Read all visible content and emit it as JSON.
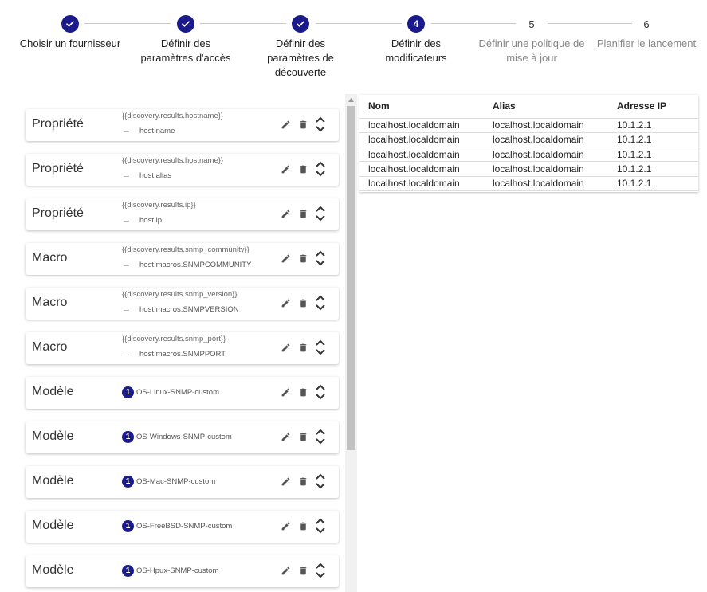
{
  "stepper": {
    "steps": [
      {
        "label": "Choisir un fournisseur",
        "number": "1",
        "state": "done"
      },
      {
        "label": "Définir des paramètres d'accès",
        "number": "2",
        "state": "done"
      },
      {
        "label": "Définir des paramètres de découverte",
        "number": "3",
        "state": "done"
      },
      {
        "label": "Définir des modificateurs",
        "number": "4",
        "state": "active"
      },
      {
        "label": "Définir une politique de mise à jour",
        "number": "5",
        "state": "todo"
      },
      {
        "label": "Planifier le lancement",
        "number": "6",
        "state": "todo"
      }
    ]
  },
  "modifiers": [
    {
      "type": "Propriété",
      "source": "{{discovery.results.hostname}}",
      "target": "host.name"
    },
    {
      "type": "Propriété",
      "source": "{{discovery.results.hostname}}",
      "target": "host.alias"
    },
    {
      "type": "Propriété",
      "source": "{{discovery.results.ip}}",
      "target": "host.ip"
    },
    {
      "type": "Macro",
      "source": "{{discovery.results.snmp_community}}",
      "target": "host.macros.SNMPCOMMUNITY"
    },
    {
      "type": "Macro",
      "source": "{{discovery.results.snmp_version}}",
      "target": "host.macros.SNMPVERSION"
    },
    {
      "type": "Macro",
      "source": "{{discovery.results.snmp_port}}",
      "target": "host.macros.SNMPPORT"
    },
    {
      "type": "Modèle",
      "badge": "1",
      "template": "OS-Linux-SNMP-custom"
    },
    {
      "type": "Modèle",
      "badge": "1",
      "template": "OS-Windows-SNMP-custom"
    },
    {
      "type": "Modèle",
      "badge": "1",
      "template": "OS-Mac-SNMP-custom"
    },
    {
      "type": "Modèle",
      "badge": "1",
      "template": "OS-FreeBSD-SNMP-custom"
    },
    {
      "type": "Modèle",
      "badge": "1",
      "template": "OS-Hpux-SNMP-custom"
    }
  ],
  "icons": {
    "edit": "pencil-icon",
    "delete": "trash-icon",
    "reorder": "unfold-icon",
    "arrow": "arrow-right-icon",
    "check": "check-icon"
  },
  "colors": {
    "accent": "#1a1a8c"
  },
  "preview_table": {
    "headers": [
      "Nom",
      "Alias",
      "Adresse IP"
    ],
    "rows": [
      [
        "localhost.localdomain",
        "localhost.localdomain",
        "10.1.2.1"
      ],
      [
        "localhost.localdomain",
        "localhost.localdomain",
        "10.1.2.1"
      ],
      [
        "localhost.localdomain",
        "localhost.localdomain",
        "10.1.2.1"
      ],
      [
        "localhost.localdomain",
        "localhost.localdomain",
        "10.1.2.1"
      ],
      [
        "localhost.localdomain",
        "localhost.localdomain",
        "10.1.2.1"
      ]
    ]
  }
}
